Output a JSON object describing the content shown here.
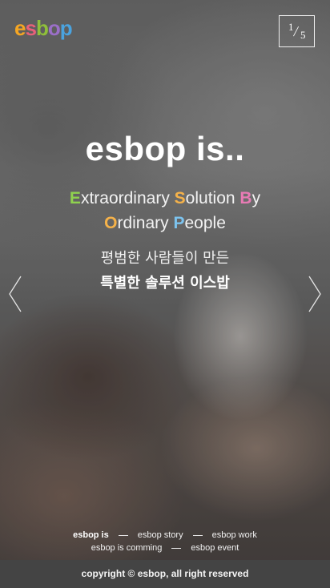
{
  "logo": {
    "letters": [
      {
        "ch": "e",
        "color": "#f5a623"
      },
      {
        "ch": "s",
        "color": "#e8607a"
      },
      {
        "ch": "b",
        "color": "#8fbf3a"
      },
      {
        "ch": "o",
        "color": "#9b6fc8"
      },
      {
        "ch": "p",
        "color": "#4aa3df"
      }
    ]
  },
  "pager": {
    "current": "1",
    "separator": "/",
    "total": "5"
  },
  "hero": {
    "headline": "esbop is..",
    "tagline_line1": [
      {
        "initial": "E",
        "rest": "xtraordinary ",
        "color": "#8fd14f"
      },
      {
        "initial": "S",
        "rest": "olution ",
        "color": "#f5b24a"
      },
      {
        "initial": "B",
        "rest": "y",
        "color": "#e77bb4"
      }
    ],
    "tagline_line2": [
      {
        "initial": "O",
        "rest": "rdinary ",
        "color": "#f5b24a"
      },
      {
        "initial": "P",
        "rest": "eople",
        "color": "#7cc3ee"
      }
    ],
    "korean_line1": "평범한 사람들이 만든",
    "korean_line2": "특별한 솔루션 이스밥"
  },
  "nav_arrows": {
    "prev_icon": "chevron-left-icon",
    "next_icon": "chevron-right-icon"
  },
  "menu": {
    "row1": [
      "esbop is",
      "esbop story",
      "esbop work"
    ],
    "row2": [
      "esbop is comming",
      "esbop event"
    ],
    "active": "esbop is"
  },
  "footer": {
    "copyright": "copyright © esbop, all right reserved"
  }
}
